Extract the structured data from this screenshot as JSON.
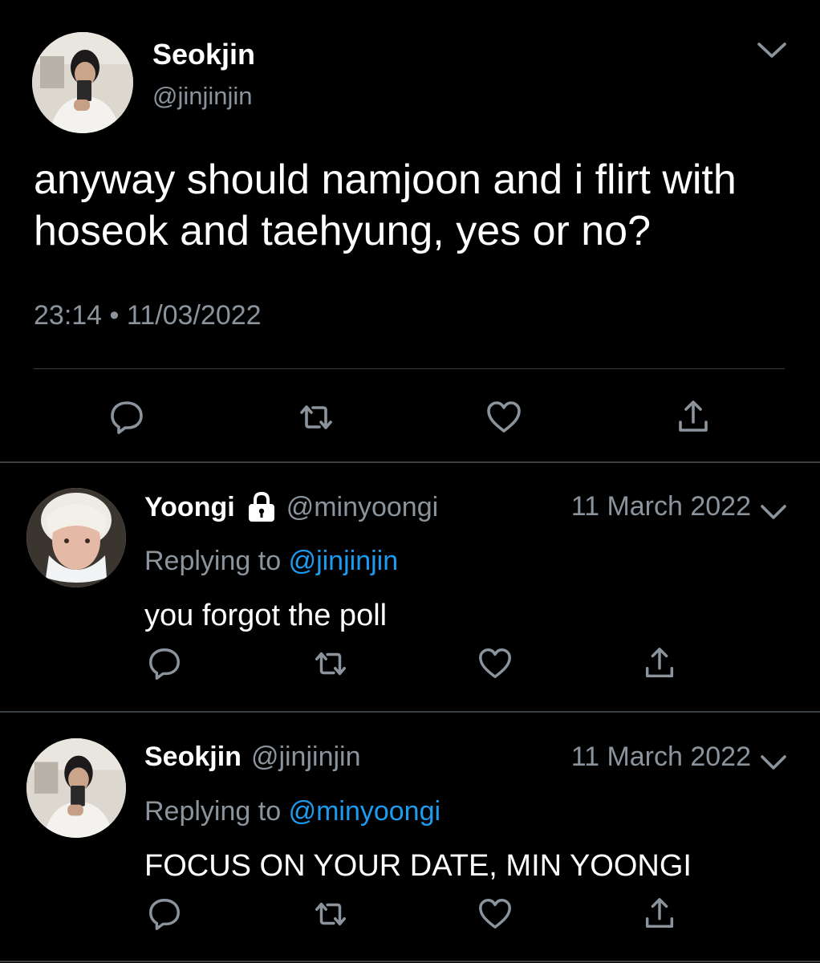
{
  "main_tweet": {
    "name": "Seokjin",
    "handle": "@jinjinjin",
    "text": "anyway should namjoon and i flirt with hoseok and taehyung, yes or no?",
    "time": "23:14",
    "separator": "•",
    "date": "11/03/2022",
    "avatar_icon": "profile-photo",
    "actions": [
      "reply-icon",
      "retweet-icon",
      "like-icon",
      "share-icon"
    ]
  },
  "replies": [
    {
      "name": "Yoongi",
      "protected": true,
      "handle": "@minyoongi",
      "date": "11 March 2022",
      "replying_prefix": "Replying to",
      "replying_handle": "@jinjinjin",
      "text": "you forgot the poll"
    },
    {
      "name": "Seokjin",
      "protected": false,
      "handle": "@jinjinjin",
      "date": "11 March 2022",
      "replying_prefix": "Replying to",
      "replying_handle": "@minyoongi",
      "text": "FOCUS ON YOUR DATE, MIN YOONGI"
    }
  ],
  "colors": {
    "background": "#000000",
    "primary_text": "#ffffff",
    "secondary_text": "#8b949d",
    "link": "#1d9bf0",
    "divider": "#3a3f44"
  }
}
